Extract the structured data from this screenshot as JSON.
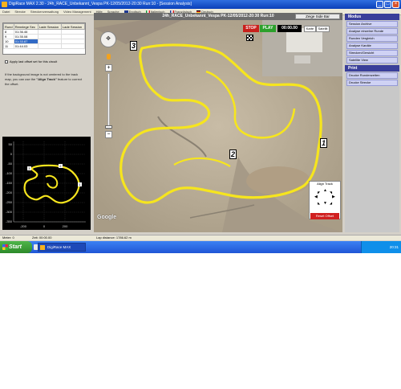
{
  "window": {
    "title": "DigiRace MAX 2.30 - 24h_RACE_Unbekannt_Vespa PK-12/05/2012-20:30 Run:10 - [Session Analysis]",
    "controls": [
      "_",
      "□",
      "×"
    ]
  },
  "menubar": {
    "items": [
      "Datei",
      "Strecke",
      "Streckenverwaltung",
      "Video Management",
      "Hilfe",
      "Sprache",
      "Englisch",
      "Italienisch",
      "Französisch",
      "Deutsch"
    ]
  },
  "laps": {
    "headers": [
      "Rund",
      "Rennlege Sec",
      "Lade Session",
      "Lade Session"
    ],
    "rows": [
      {
        "lap": "8",
        "time": "01:36.46",
        "selected": false
      },
      {
        "lap": "9",
        "time": "01:35.08",
        "selected": false
      },
      {
        "lap": "10",
        "time": "01:33.87",
        "selected": true
      },
      {
        "lap": "11",
        "time": "01:44.03",
        "selected": false
      }
    ]
  },
  "offset": {
    "checkbox_label": "Apply last offset set for this circuit",
    "hint_prefix": "If the background image is not centered to the track map, you can use the",
    "hint_bold": "\"Align Track\"",
    "hint_suffix": "feature to correct the offset."
  },
  "minichart": {
    "x_ticks": [
      "-200",
      "0",
      "200"
    ],
    "y_ticks": [
      "50",
      "0",
      "-50",
      "-100",
      "-150",
      "-200",
      "-250",
      "-300",
      "-350"
    ],
    "turn_labels": [
      "1",
      "2",
      "3"
    ]
  },
  "map": {
    "header": "24h_RACE_Unbekannt_Vespa PK-12/05/2012-20:30 Run:10",
    "sidebar_toggle": "Zeige Side Bar",
    "stop_label": "STOP",
    "play_label": "PLAY",
    "timer": "00:00.00",
    "karte_label": "Karte",
    "satellit_label": "Satellit",
    "google_logo": "Google",
    "turns": [
      "1",
      "2",
      "3"
    ],
    "align_label": "Align Track",
    "reset_offset_label": "Reset Offset",
    "colors": {
      "track": "#f6e51e",
      "terrain": "#b8ab95"
    }
  },
  "rightpanel": {
    "modus_title": "Modus",
    "modus_items": [
      "Session Archive",
      "Analyse einzelne Runde",
      "Runden Vergleich",
      "Analyse Kanäle",
      "Strecken/Gewicht",
      "Satellite View"
    ],
    "print_title": "Print",
    "print_items": [
      "Drucke Rundenzeiten",
      "Drucke Strecke"
    ]
  },
  "status": {
    "meter": "Meter: 0",
    "zeit": "Zeit: 00:00.00",
    "lap_distance": "Lap distance: 1786.62 m"
  },
  "taskbar": {
    "start_label": "Start",
    "app_label": "DigiRace MAX",
    "clock": "20:31"
  }
}
